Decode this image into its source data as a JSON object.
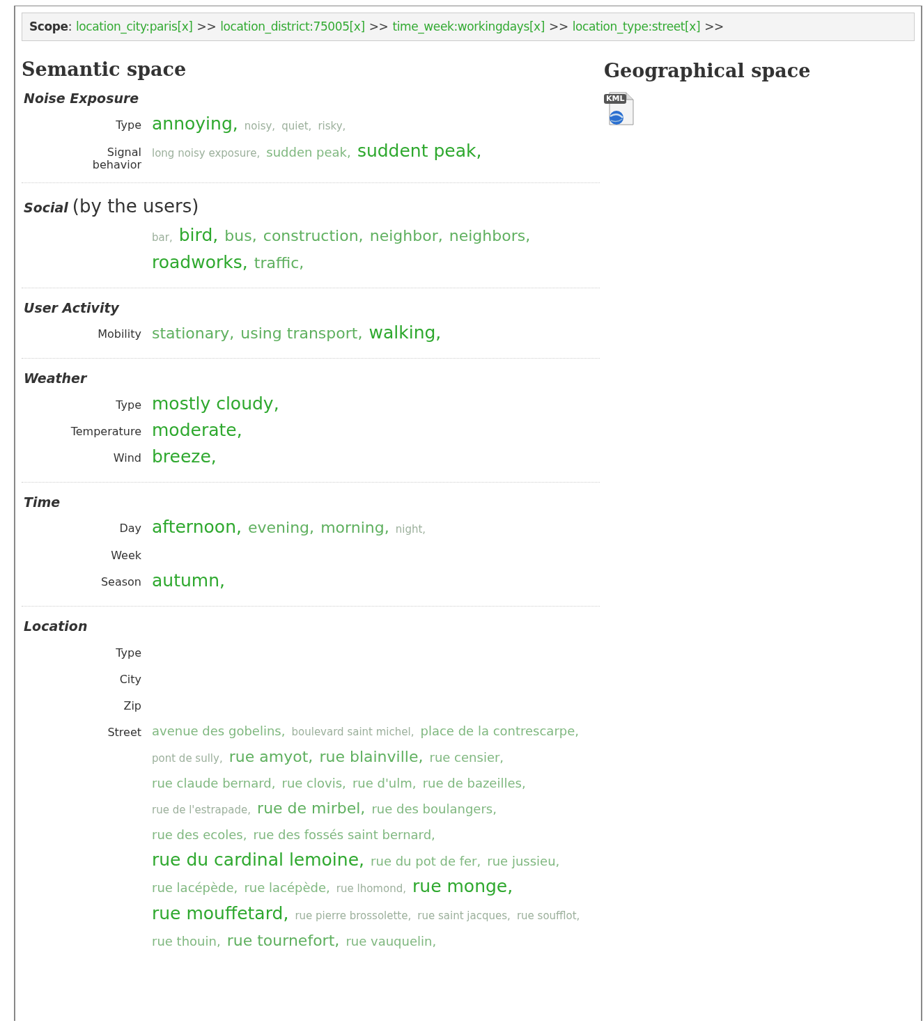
{
  "scope": {
    "label": "Scope",
    "colon": ":",
    "parts": [
      {
        "kind": "link",
        "text": "location_city:paris[x]"
      },
      {
        "kind": "sep",
        "text": ">>"
      },
      {
        "kind": "link",
        "text": "location_district:75005[x]"
      },
      {
        "kind": "sep",
        "text": ">>"
      },
      {
        "kind": "link",
        "text": "time_week:workingdays[x]"
      },
      {
        "kind": "sep",
        "text": ">>"
      },
      {
        "kind": "link",
        "text": "location_type:street[x]"
      },
      {
        "kind": "sep",
        "text": ">>"
      }
    ]
  },
  "semantic": {
    "title": "Semantic space",
    "sections": [
      {
        "title": "Noise Exposure",
        "rows": [
          {
            "label": "Type",
            "tags": [
              {
                "text": "annoying,",
                "kind": "top"
              },
              {
                "text": "noisy,",
                "kind": "rare"
              },
              {
                "text": "quiet,",
                "kind": "rare"
              },
              {
                "text": "risky,",
                "kind": "rare"
              }
            ]
          },
          {
            "label": "Signal behavior",
            "tags": [
              {
                "text": "long noisy exposure,",
                "kind": "rare"
              },
              {
                "text": "sudden peak,",
                "kind": "some"
              },
              {
                "text": "suddent peak,",
                "kind": "top"
              }
            ]
          }
        ]
      },
      {
        "title": "Social",
        "subtitle": "(by the users)",
        "rows": [
          {
            "tags": [
              {
                "text": "bar,",
                "kind": "rare"
              },
              {
                "text": "bird,",
                "kind": "top"
              },
              {
                "text": "bus,",
                "kind": "many"
              },
              {
                "text": "construction,",
                "kind": "many"
              },
              {
                "text": "neighbor,",
                "kind": "many"
              },
              {
                "text": "neighbors,",
                "kind": "many"
              },
              {
                "text": "roadworks,",
                "kind": "top"
              },
              {
                "text": "traffic,",
                "kind": "many"
              }
            ]
          }
        ]
      },
      {
        "title": "User Activity",
        "rows": [
          {
            "label": "Mobility",
            "tags": [
              {
                "text": "stationary,",
                "kind": "many"
              },
              {
                "text": "using transport,",
                "kind": "many"
              },
              {
                "text": "walking,",
                "kind": "top"
              }
            ]
          }
        ]
      },
      {
        "title": "Weather",
        "rows": [
          {
            "label": "Type",
            "tags": [
              {
                "text": "mostly cloudy,",
                "kind": "top"
              }
            ]
          },
          {
            "label": "Temperature",
            "tags": [
              {
                "text": "moderate,",
                "kind": "top"
              }
            ]
          },
          {
            "label": "Wind",
            "tags": [
              {
                "text": "breeze,",
                "kind": "top"
              }
            ]
          }
        ]
      },
      {
        "title": "Time",
        "rows": [
          {
            "label": "Day",
            "tags": [
              {
                "text": "afternoon,",
                "kind": "top"
              },
              {
                "text": "evening,",
                "kind": "many"
              },
              {
                "text": "morning,",
                "kind": "many"
              },
              {
                "text": "night,",
                "kind": "rare"
              }
            ]
          },
          {
            "label": "Week"
          },
          {
            "label": "Season",
            "tags": [
              {
                "text": "autumn,",
                "kind": "top"
              }
            ]
          }
        ]
      },
      {
        "title": "Location",
        "rows": [
          {
            "label": "Type"
          },
          {
            "label": "City"
          },
          {
            "label": "Zip"
          },
          {
            "label": "Street",
            "tags": [
              {
                "text": "avenue des gobelins,",
                "kind": "some"
              },
              {
                "text": "boulevard saint michel,",
                "kind": "rare"
              },
              {
                "text": "place de la contrescarpe,",
                "kind": "some"
              },
              {
                "text": "pont de sully,",
                "kind": "rare"
              },
              {
                "text": "rue amyot,",
                "kind": "many"
              },
              {
                "text": "rue blainville,",
                "kind": "many"
              },
              {
                "text": "rue censier,",
                "kind": "some"
              },
              {
                "text": "rue claude bernard,",
                "kind": "some"
              },
              {
                "text": "rue clovis,",
                "kind": "some"
              },
              {
                "text": "rue d'ulm,",
                "kind": "some"
              },
              {
                "text": "rue de bazeilles,",
                "kind": "some"
              },
              {
                "text": "rue de l'estrapade,",
                "kind": "rare"
              },
              {
                "text": "rue de mirbel,",
                "kind": "many"
              },
              {
                "text": "rue des boulangers,",
                "kind": "some"
              },
              {
                "text": "rue des ecoles,",
                "kind": "some"
              },
              {
                "text": "rue des fossés saint bernard,",
                "kind": "some"
              },
              {
                "text": "rue du cardinal lemoine,",
                "kind": "top"
              },
              {
                "text": "rue du pot de fer,",
                "kind": "some"
              },
              {
                "text": "rue jussieu,",
                "kind": "some"
              },
              {
                "text": "rue lacépède,",
                "kind": "some"
              },
              {
                "text": "rue lacépède,",
                "kind": "some"
              },
              {
                "text": "rue lhomond,",
                "kind": "rare"
              },
              {
                "text": "rue monge,",
                "kind": "top"
              },
              {
                "text": "rue mouffetard,",
                "kind": "top"
              },
              {
                "text": "rue pierre brossolette,",
                "kind": "rare"
              },
              {
                "text": "rue saint jacques,",
                "kind": "rare"
              },
              {
                "text": "rue soufflot,",
                "kind": "rare"
              },
              {
                "text": "rue thouin,",
                "kind": "some"
              },
              {
                "text": "rue tournefort,",
                "kind": "many"
              },
              {
                "text": "rue vauquelin,",
                "kind": "some"
              }
            ]
          }
        ]
      }
    ]
  },
  "geographical": {
    "title": "Geographical space",
    "export": {
      "badge": "KML"
    }
  }
}
